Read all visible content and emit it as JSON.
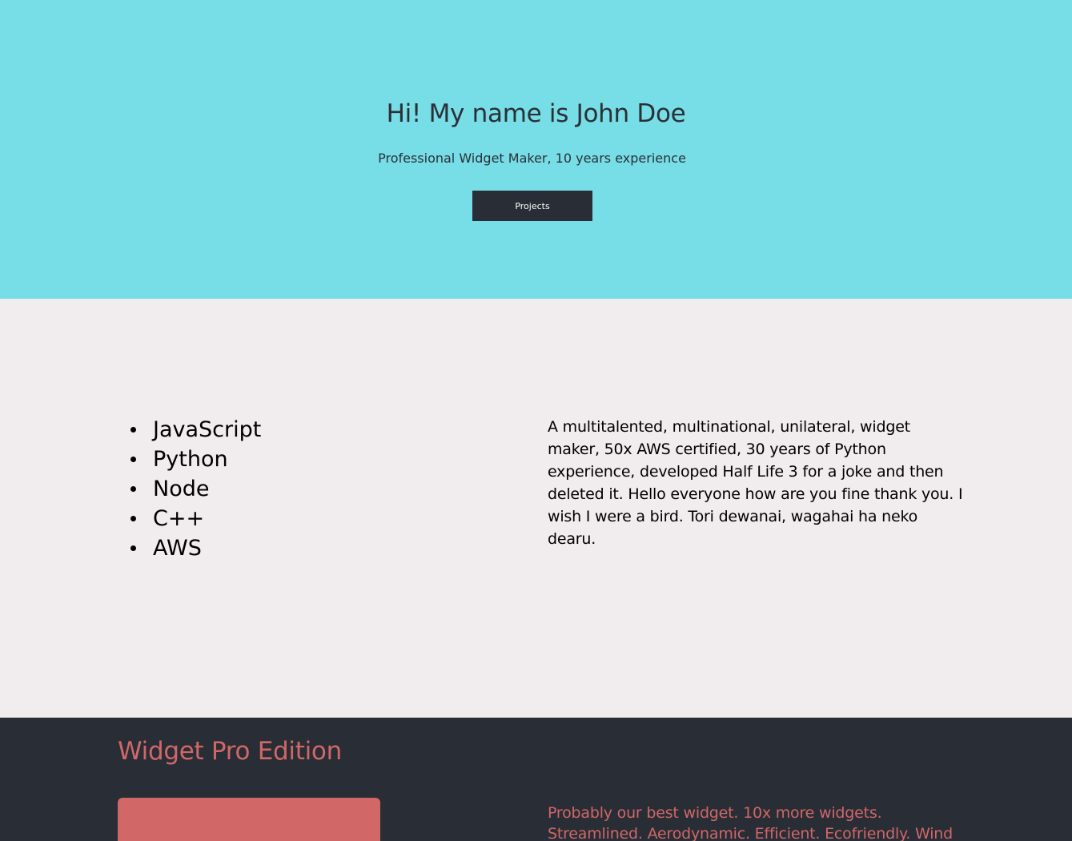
{
  "hero": {
    "title": "Hi! My name is John Doe",
    "subtitle": "Professional Widget Maker, 10 years experience",
    "button_label": "Projects"
  },
  "about": {
    "skills": [
      "JavaScript",
      "Python",
      "Node",
      "C++",
      "AWS"
    ],
    "bio": "A multitalented, multinational, unilateral, widget maker, 50x AWS certified, 30 years of Python experience, developed Half Life 3 for a joke and then deleted it. Hello everyone how are you fine thank you. I wish I were a bird. Tori dewanai, wagahai ha neko dearu."
  },
  "product": {
    "title": "Widget Pro Edition",
    "description": "Probably our best widget. 10x more widgets. Streamlined. Aerodynamic. Efficient. Ecofriendly. Wind resistant."
  },
  "colors": {
    "hero_bg": "#77dde7",
    "about_bg": "#f1ecee",
    "product_bg": "#282d36",
    "accent": "#d16767"
  }
}
